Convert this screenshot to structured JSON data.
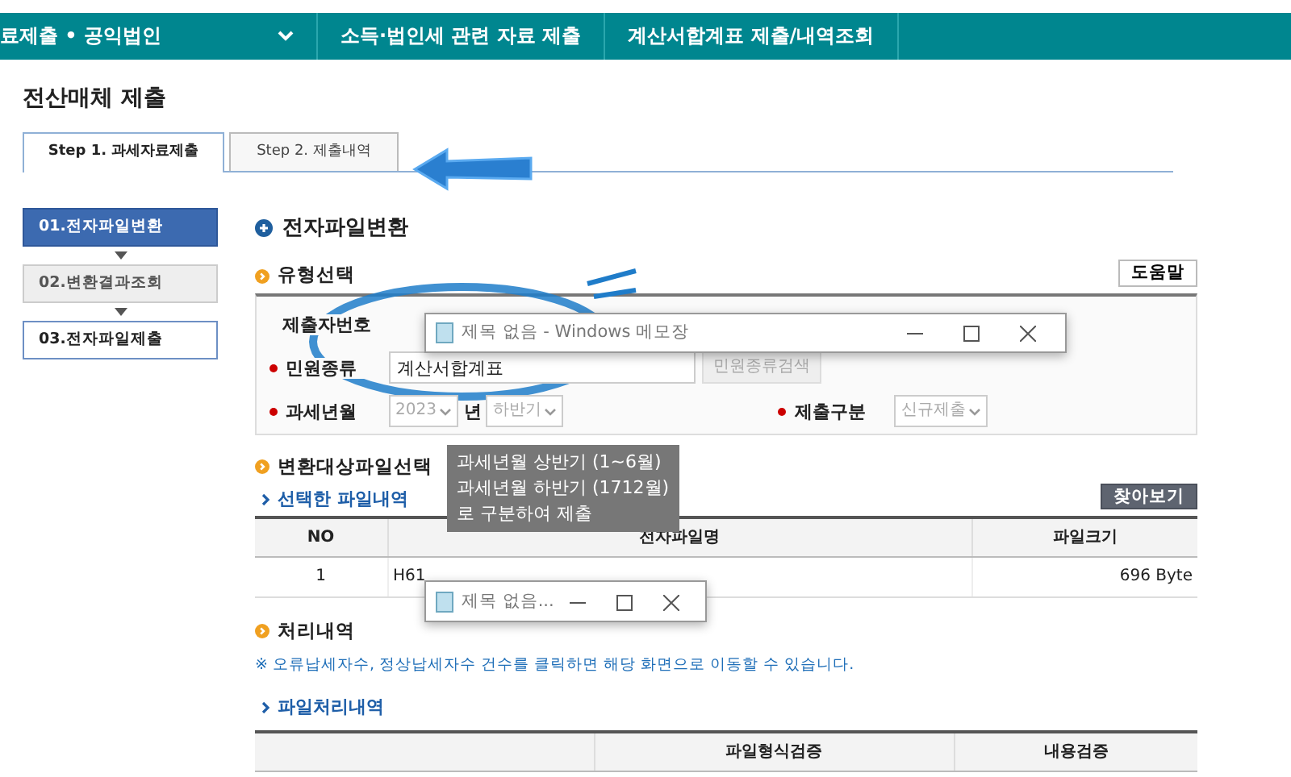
{
  "breadcrumb": [
    "료제출 • 공익법인",
    "소득·법인세 관련 자료 제출",
    "계산서합계표 제출/내역조회"
  ],
  "page_title": "전산매체 제출",
  "tabs": [
    {
      "label": "Step 1. 과세자료제출",
      "selected": true
    },
    {
      "label": "Step 2. 제출내역",
      "selected": false
    }
  ],
  "steps": [
    {
      "label": "01.전자파일변환",
      "kind": "current"
    },
    {
      "label": "02.변환결과조회",
      "kind": "done"
    },
    {
      "label": "03.전자파일제출",
      "kind": "next"
    }
  ],
  "section_title": "전자파일변환",
  "type_select": {
    "heading": "유형선택",
    "help_button": "도움말",
    "submitter_label": "제출자번호",
    "civil_label": "민원종류",
    "civil_value": "계산서합계표",
    "civil_button": "민원종류검색",
    "period_label": "과세년월",
    "year": "2023",
    "year_unit": "년",
    "half": "하반기",
    "kind_label": "제출구분",
    "kind_value": "신규제출"
  },
  "tooltip": [
    "과세년월 상반기 (1~6월)",
    "과세년월 하반기 (1712월)",
    "로 구분하여 제출"
  ],
  "popups": [
    {
      "title": "제목 없음 - Windows 메모장"
    },
    {
      "title": "제목 없음..."
    }
  ],
  "file_select": {
    "heading": "변환대상파일선택",
    "subheading": "선택한 파일내역",
    "browse_button": "찾아보기",
    "columns": [
      "NO",
      "전자파일명",
      "파일크기"
    ],
    "rows": [
      [
        "1",
        "H61",
        "696 Byte"
      ]
    ]
  },
  "processing": {
    "heading": "처리내역",
    "note": "※ 오류납세자수, 정상납세자수 건수를 클릭하면 해당 화면으로 이동할 수 있습니다.",
    "subheading": "파일처리내역",
    "columns": [
      "파일형식검증",
      "내용검증"
    ]
  }
}
